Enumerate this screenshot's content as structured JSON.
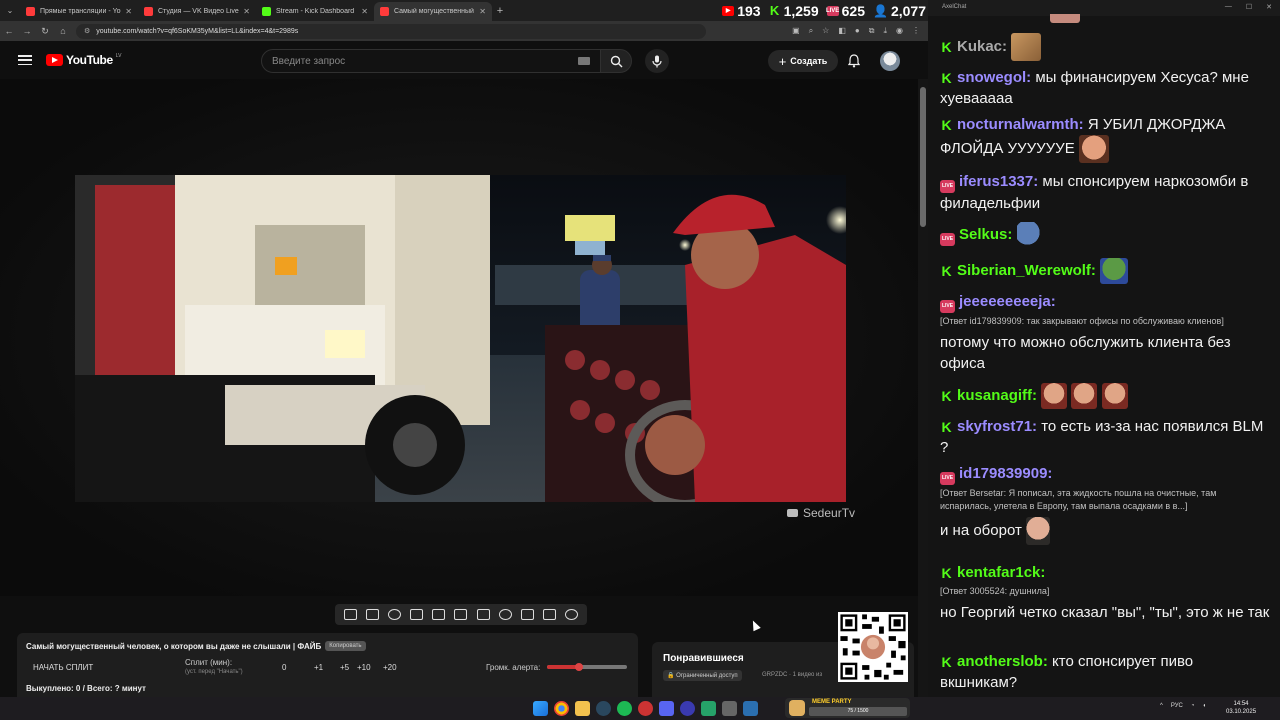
{
  "browser": {
    "tabs": [
      {
        "title": "Прямые трансляции - YouTube",
        "favicon_color": "#ff3b3b"
      },
      {
        "title": "Студия — VK Видео Live",
        "favicon_color": "#ff3b3b"
      },
      {
        "title": "Stream - Kick Dashboard",
        "favicon_color": "#53fc18"
      },
      {
        "title": "Самый могущественный ч...",
        "favicon_color": "#ff3b3b"
      }
    ],
    "new_tab": "+",
    "url": "youtube.com/watch?v=qf6SoKM35yM&list=LL&index=4&t=2989s"
  },
  "stream_stats": [
    {
      "platform": "youtube",
      "value": "193",
      "color": "#ff0000"
    },
    {
      "platform": "kick",
      "value": "1,259",
      "color": "#53fc18"
    },
    {
      "platform": "vk",
      "value": "625",
      "color": "#d63a5e"
    },
    {
      "platform": "total",
      "value": "2,077",
      "color": "#7aa7ff"
    }
  ],
  "youtube": {
    "logo_text": "YouTube",
    "region": "LV",
    "search_placeholder": "Введите запрос",
    "create_label": "Создать"
  },
  "player": {
    "watermark": "SedeurTv"
  },
  "split_panel": {
    "video_title": "Самый могущественный человек, о котором вы даже не слышали | ФАЙБ",
    "copy_button": "Копировать",
    "start_split": "НАЧАТЬ СПЛИТ",
    "split_label": "Сплит (мин):",
    "split_hint": "(уст. перед \"Начать\")",
    "split_value": "0",
    "increments": [
      "+1",
      "+5",
      "+10",
      "+20"
    ],
    "alert_volume_label": "Громк. алерта:",
    "alert_volume": 0.4,
    "paid_summary": "Выкуплено: 0 / Всего: ? минут"
  },
  "liked": {
    "title": "Понравившиеся",
    "access": "Ограниченный доступ",
    "meta": "GRPZDC · 1 видео из"
  },
  "chat": {
    "window_title": "AxelChat",
    "messages": [
      {
        "platform": "kick",
        "user": "Kukac:",
        "user_color": "#aaaaaa",
        "text": "",
        "emote": "cat"
      },
      {
        "platform": "kick",
        "user": "snowegol:",
        "user_color": "#9b8cff",
        "text": "мы финансируем Хесуса? мне хуевааааа"
      },
      {
        "platform": "kick",
        "user": "nocturnalwarmth:",
        "user_color": "#9b8cff",
        "text": "Я УБИЛ ДЖОРДЖА ФЛОЙДА УУУУУУЕ",
        "emote": "face"
      },
      {
        "platform": "vk",
        "user": "iferus1337:",
        "user_color": "#9b8cff",
        "text": "мы спонсируем наркозомби в филадельфии"
      },
      {
        "platform": "vk",
        "user": "Selkus:",
        "user_color": "#53fc18",
        "text": "",
        "emote": "bird"
      },
      {
        "platform": "kick",
        "user": "Siberian_Werewolf:",
        "user_color": "#53fc18",
        "text": "",
        "emote": "pepe"
      },
      {
        "platform": "vk",
        "user": "jeeeeeeeeeja:",
        "user_color": "#9b8cff",
        "reply": "[Ответ id179839909: так закрывают офисы по обслуживаю клиенов]",
        "text": "потому что можно обслужить клиента без офиса"
      },
      {
        "platform": "kick",
        "user": "kusanagiff:",
        "user_color": "#53fc18",
        "text": "",
        "emote": "triple"
      },
      {
        "platform": "kick",
        "user": "skyfrost71:",
        "user_color": "#9b8cff",
        "text": "то есть из-за нас появился BLM ?"
      },
      {
        "platform": "vk",
        "user": "id179839909:",
        "user_color": "#9b8cff",
        "reply": "[Ответ Bersetar: Я пописал, эта жидкость пошла на очистные, там испарилась, улетела в Европу, там выпала осадками в в...]",
        "text": "и на оборот",
        "emote": "face2"
      },
      {
        "platform": "kick",
        "user": "kentafar1ck:",
        "user_color": "#53fc18",
        "reply": "[Ответ 3005524: душнила]",
        "text": "но Георгий четко сказал \"вы\", \"ты\", это ж не так"
      },
      {
        "platform": "kick",
        "user": "anotherslob:",
        "user_color": "#53fc18",
        "text": "кто спонсирует пиво вкшникам?"
      }
    ]
  },
  "taskbar": {
    "meme_label": "MEME PARTY",
    "meme_progress": "75 / 1500",
    "language": "РУС",
    "time": "14:54",
    "date": "03.10.2025"
  }
}
